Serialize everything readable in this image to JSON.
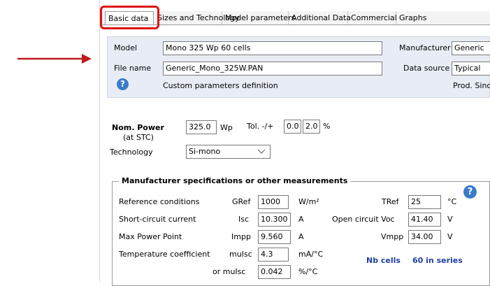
{
  "tabs": [
    {
      "label": "Basic data",
      "active": true
    },
    {
      "label": "Sizes and Technology"
    },
    {
      "label": "Model parameters"
    },
    {
      "label": "Additional Data"
    },
    {
      "label": "Commercial"
    },
    {
      "label": "Graphs"
    }
  ],
  "header": {
    "model_label": "Model",
    "model_value": "Mono 325 Wp  60 cells",
    "manufacturer_label": "Manufacturer",
    "manufacturer_value": "Generic",
    "filename_label": "File name",
    "filename_value": "Generic_Mono_325W.PAN",
    "datasource_label": "Data source",
    "datasource_value": "Typical",
    "custom_text": "Custom parameters definition",
    "prod_since": "Prod. Since"
  },
  "power": {
    "nom_power_label": "Nom. Power",
    "at_stc": "(at STC)",
    "value": "325.0",
    "unit": "Wp",
    "tol_label": "Tol. -/+",
    "tol_minus": "0.0",
    "tol_plus": "2.0",
    "tol_unit": "%"
  },
  "technology": {
    "label": "Technology",
    "value": "Si-mono"
  },
  "specs": {
    "title": "Manufacturer specifications or other measurements",
    "ref_cond": "Reference conditions",
    "gref_label": "GRef",
    "gref_value": "1000",
    "gref_unit": "W/m²",
    "tref_label": "TRef",
    "tref_value": "25",
    "tref_unit": "°C",
    "sc_label": "Short-circuit current",
    "isc_label": "Isc",
    "isc_value": "10.300",
    "isc_unit": "A",
    "voc_label": "Open circuit Voc",
    "voc_value": "41.40",
    "voc_unit": "V",
    "mpp_label": "Max Power Point",
    "impp_label": "Impp",
    "impp_value": "9.560",
    "impp_unit": "A",
    "vmpp_label": "Vmpp",
    "vmpp_value": "34.00",
    "vmpp_unit": "V",
    "temp_label": "Temperature coefficient",
    "muisc_label": "muIsc",
    "muisc_value": "4.3",
    "muisc_unit": "mA/°C",
    "or_label": "or  muIsc",
    "muisc2_value": "0.042",
    "muisc2_unit": "%/°C",
    "nb_cells_label": "Nb cells",
    "nb_cells_value": "60 in series"
  },
  "colors": {
    "highlight": "#e01010",
    "arrow": "#c01a1a",
    "help": "#3a7bc8",
    "nb_cells": "#1f3fa0"
  }
}
